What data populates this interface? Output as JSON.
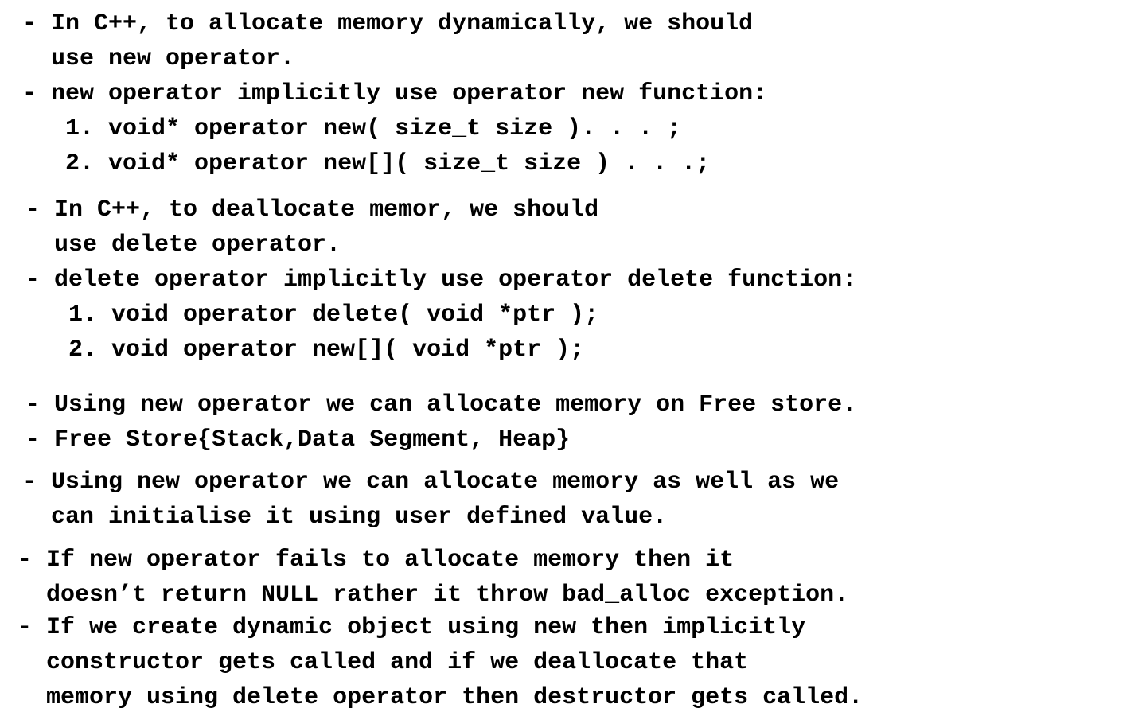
{
  "page_text": {
    "lines": [
      "- In C++, to allocate memory dynamically, we should",
      "  use new operator.",
      "- new operator implicitly use operator new function:",
      "   1. void* operator new( size_t size ). . . ;",
      "   2. void* operator new[]( size_t size ) . . .;",
      "- In C++, to deallocate memor, we should",
      "  use delete operator.",
      "- delete operator implicitly use operator delete function:",
      "   1. void operator delete( void *ptr );",
      "   2. void operator new[]( void *ptr );",
      "- Using new operator we can allocate memory on Free store.",
      "- Free Store{Stack,Data Segment, Heap}",
      "- Using new operator we can allocate memory as well as we",
      "  can initialise it using user defined value.",
      "- If new operator fails to allocate memory then it",
      "  doesn’t return NULL rather it throw bad_alloc exception.",
      "- If we create dynamic object using new then implicitly",
      "  constructor gets called and if we deallocate that",
      "  memory using delete operator then destructor gets called."
    ]
  }
}
